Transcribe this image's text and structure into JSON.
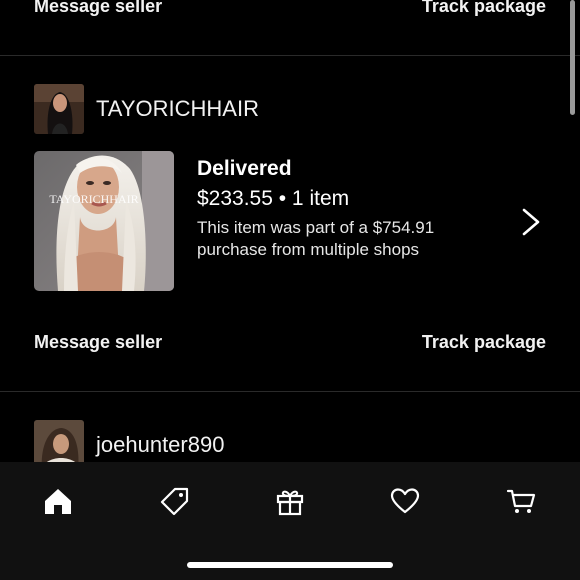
{
  "previous_order": {
    "message_label": "Message seller",
    "track_label": "Track package"
  },
  "order": {
    "shop_name": "TAYORICHHAIR",
    "thumbnail_watermark": "TAYORICHHAIR",
    "status": "Delivered",
    "price_line": "$233.55 • 1 item",
    "note": "This item was part of a $754.91 purchase from multiple shops",
    "message_label": "Message seller",
    "track_label": "Track package"
  },
  "next_order": {
    "shop_name": "joehunter890"
  },
  "tab_bar": {
    "items": [
      {
        "icon": "home-icon",
        "active": true
      },
      {
        "icon": "tag-icon",
        "active": false
      },
      {
        "icon": "gift-icon",
        "active": false
      },
      {
        "icon": "heart-icon",
        "active": false
      },
      {
        "icon": "cart-icon",
        "active": false
      }
    ]
  },
  "colors": {
    "background": "#000000",
    "tab_bar_background": "#111111",
    "text": "#ffffff",
    "divider": "#2a2a2a"
  }
}
